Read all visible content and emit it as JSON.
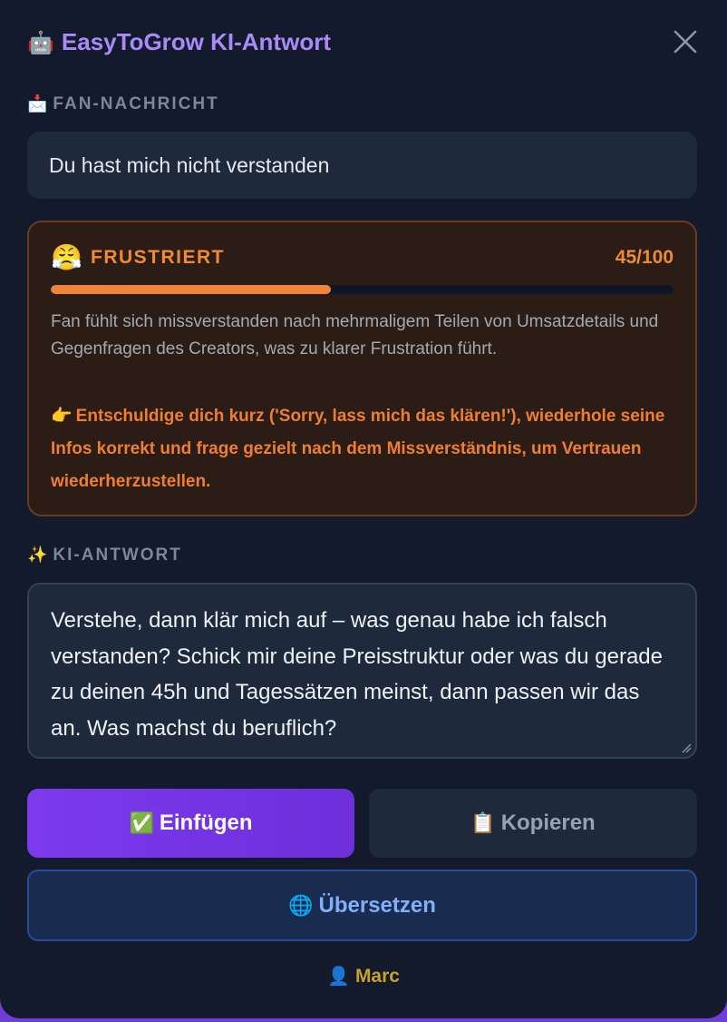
{
  "header": {
    "icon": "robot-icon",
    "icon_glyph": "🤖",
    "title": "EasyToGrow KI-Antwort",
    "close_icon": "close-icon"
  },
  "fan_message": {
    "label_icon": "inbox-icon",
    "label_glyph": "📩",
    "label": "FAN-NACHRICHT",
    "text": "Du hast mich nicht verstanden"
  },
  "mood": {
    "icon": "frustrated-face-icon",
    "icon_glyph": "😤",
    "name": "FRUSTRIERT",
    "score_text": "45/100",
    "score_value": 45,
    "score_max": 100,
    "description": "Fan fühlt sich missverstanden nach mehrmaligem Teilen von Umsatzdetails und Gegenfragen des Creators, was zu klarer Frustration führt.",
    "tip_icon": "pointing-hand-icon",
    "tip_glyph": "👉",
    "tip": "Entschuldige dich kurz ('Sorry, lass mich das klären!'), wiederhole seine Infos korrekt und frage gezielt nach dem Missverständnis, um Vertrauen wiederherzustellen.",
    "color": "#f08a36"
  },
  "reply": {
    "label_icon": "sparkles-icon",
    "label_glyph": "✨",
    "label": "KI-ANTWORT",
    "text": "Verstehe, dann klär mich auf – was genau habe ich falsch verstanden? Schick mir deine Preisstruktur oder was du gerade zu deinen 45h und Tagessätzen meinst, dann passen wir das an. Was machst du beruflich?"
  },
  "actions": {
    "insert_icon": "check-mark-icon",
    "insert_glyph": "✅",
    "insert_label": "Einfügen",
    "copy_icon": "clipboard-icon",
    "copy_glyph": "📋",
    "copy_label": "Kopieren",
    "translate_icon": "globe-icon",
    "translate_glyph": "🌐",
    "translate_label": "Übersetzen"
  },
  "user": {
    "icon": "user-icon",
    "icon_glyph": "👤",
    "name": "Marc"
  },
  "colors": {
    "accent": "#7c3aed",
    "background": "#121a2b",
    "mood_accent": "#f08a36",
    "translate": "#7fb0f8",
    "user": "#c9a227"
  }
}
